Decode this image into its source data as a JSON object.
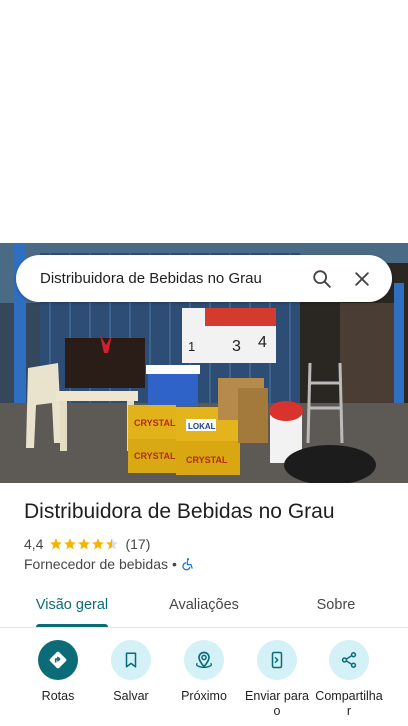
{
  "search": {
    "query": "Distribuidora de Bebidas no Grau"
  },
  "place": {
    "name": "Distribuidora de Bebidas no Grau",
    "rating": "4,4",
    "review_count": "(17)",
    "stars_value": 4.4,
    "category": "Fornecedor de bebidas",
    "separator": "•"
  },
  "photo": {
    "sign_bebidas": [
      "1",
      "3",
      "4"
    ],
    "crate_labels": [
      "CRYSTAL",
      "LOKAL",
      "CRYSTAL",
      "CRYSTAL"
    ]
  },
  "tabs": [
    {
      "label": "Visão geral",
      "active": true
    },
    {
      "label": "Avaliações",
      "active": false
    },
    {
      "label": "Sobre",
      "active": false
    }
  ],
  "actions": [
    {
      "label": "Rotas",
      "icon": "directions-icon"
    },
    {
      "label": "Salvar",
      "icon": "bookmark-icon"
    },
    {
      "label": "Próximo",
      "icon": "nearby-icon"
    },
    {
      "label": "Enviar para o",
      "icon": "send-to-phone-icon"
    },
    {
      "label": "Compartilhar",
      "icon": "share-icon"
    }
  ],
  "colors": {
    "accent": "#0b6c78",
    "action_bg": "#d3f1f6",
    "star": "#f4b400"
  }
}
